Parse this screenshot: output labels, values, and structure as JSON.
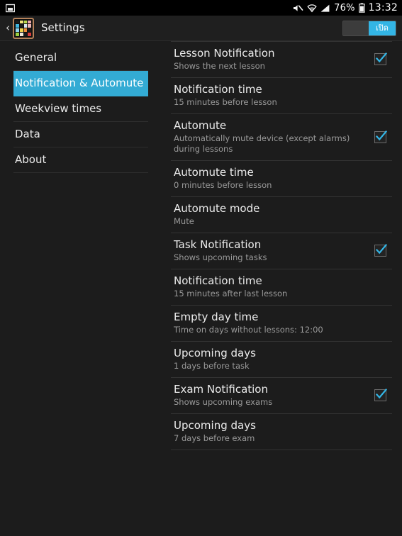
{
  "statusbar": {
    "left_icons": [
      {
        "name": "screenshot-icon",
        "glyph": "▣"
      }
    ],
    "mute_icon": "volume-mute-icon",
    "wifi_icon": "wifi-icon",
    "signal_icon": "cellular-signal-icon",
    "battery_label": "76%",
    "battery_icon": "battery-icon",
    "clock": "13:32"
  },
  "actionbar": {
    "back_label": "‹",
    "app_icon_name": "timetable-app-icon",
    "app_icon_colors": [
      "#1a1a1a",
      "#efe27a",
      "#b7d84b",
      "#f0a8a8",
      "#3fb6e0",
      "#1a1a1a",
      "#d8e8f0",
      "#efb6b6",
      "#8fd3ef",
      "#f0d24b",
      "#f08c3c",
      "#1a1a1a",
      "#9ccf3f",
      "#f0e8d8",
      "#1a1a1a",
      "#d93b3b"
    ],
    "title": "Settings",
    "toggle_label": "เปิด",
    "toggle_on": true,
    "accent": "#33b5e5"
  },
  "sidebar": {
    "selected_index": 1,
    "items": [
      {
        "label": "General"
      },
      {
        "label": "Notification & Automute"
      },
      {
        "label": "Weekview times"
      },
      {
        "label": "Data"
      },
      {
        "label": "About"
      }
    ]
  },
  "preferences": {
    "items": [
      {
        "title": "Lesson Notification",
        "summary": "Shows the next lesson",
        "has_checkbox": true,
        "checked": true
      },
      {
        "title": "Notification time",
        "summary": "15 minutes before lesson",
        "has_checkbox": false,
        "checked": false
      },
      {
        "title": "Automute",
        "summary": "Automatically mute device (except alarms) during lessons",
        "has_checkbox": true,
        "checked": true
      },
      {
        "title": "Automute time",
        "summary": "0 minutes before lesson",
        "has_checkbox": false,
        "checked": false
      },
      {
        "title": "Automute mode",
        "summary": "Mute",
        "has_checkbox": false,
        "checked": false
      },
      {
        "title": "Task Notification",
        "summary": "Shows upcoming tasks",
        "has_checkbox": true,
        "checked": true
      },
      {
        "title": "Notification time",
        "summary": "15 minutes after last lesson",
        "has_checkbox": false,
        "checked": false
      },
      {
        "title": "Empty day time",
        "summary": "Time on days without lessons: 12:00",
        "has_checkbox": false,
        "checked": false
      },
      {
        "title": "Upcoming days",
        "summary": "1 days before task",
        "has_checkbox": false,
        "checked": false
      },
      {
        "title": "Exam Notification",
        "summary": "Shows upcoming exams",
        "has_checkbox": true,
        "checked": true
      },
      {
        "title": "Upcoming days",
        "summary": "7 days before exam",
        "has_checkbox": false,
        "checked": false
      }
    ]
  },
  "colors": {
    "background": "#1c1c1c",
    "statusbar_bg": "#000000",
    "actionbar_bg": "#1f1f1f",
    "accent_blue": "#33b5e5",
    "selected_blue": "#33abd4",
    "divider": "#333333",
    "title_text": "#ececec",
    "summary_text": "#9a9a9a"
  }
}
